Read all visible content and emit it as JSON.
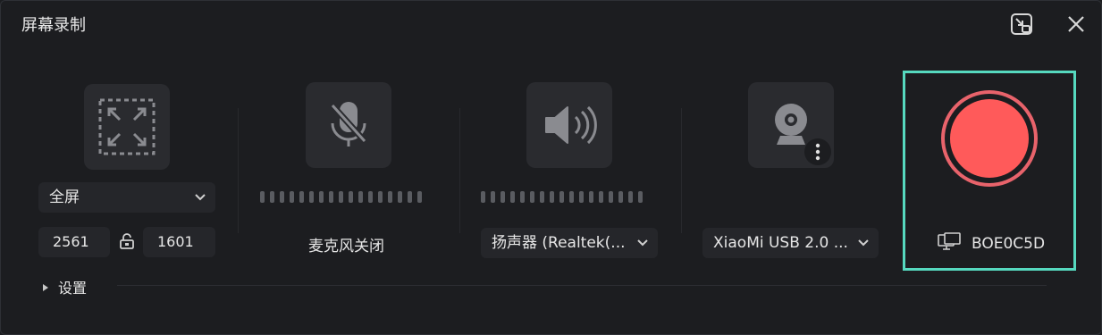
{
  "window": {
    "title": "屏幕录制"
  },
  "capture": {
    "mode_label": "全屏",
    "width": "2561",
    "height": "1601"
  },
  "microphone": {
    "status": "麦克风关闭"
  },
  "speaker": {
    "device": "扬声器 (Realtek(..."
  },
  "camera": {
    "device": "XiaoMi USB 2.0 ..."
  },
  "display": {
    "name": "BOE0C5D"
  },
  "settings": {
    "label": "设置"
  },
  "colors": {
    "accent": "#56d9bf",
    "record": "#ff5a5a",
    "record_ring": "#e8636b"
  },
  "icons": [
    "minimize-to-corner-icon",
    "close-icon",
    "fullscreen-region-icon",
    "mic-off-icon",
    "speaker-icon",
    "webcam-icon",
    "more-vertical-icon",
    "chevron-down-icon",
    "lock-ratio-icon",
    "monitor-icon",
    "triangle-right-icon"
  ]
}
